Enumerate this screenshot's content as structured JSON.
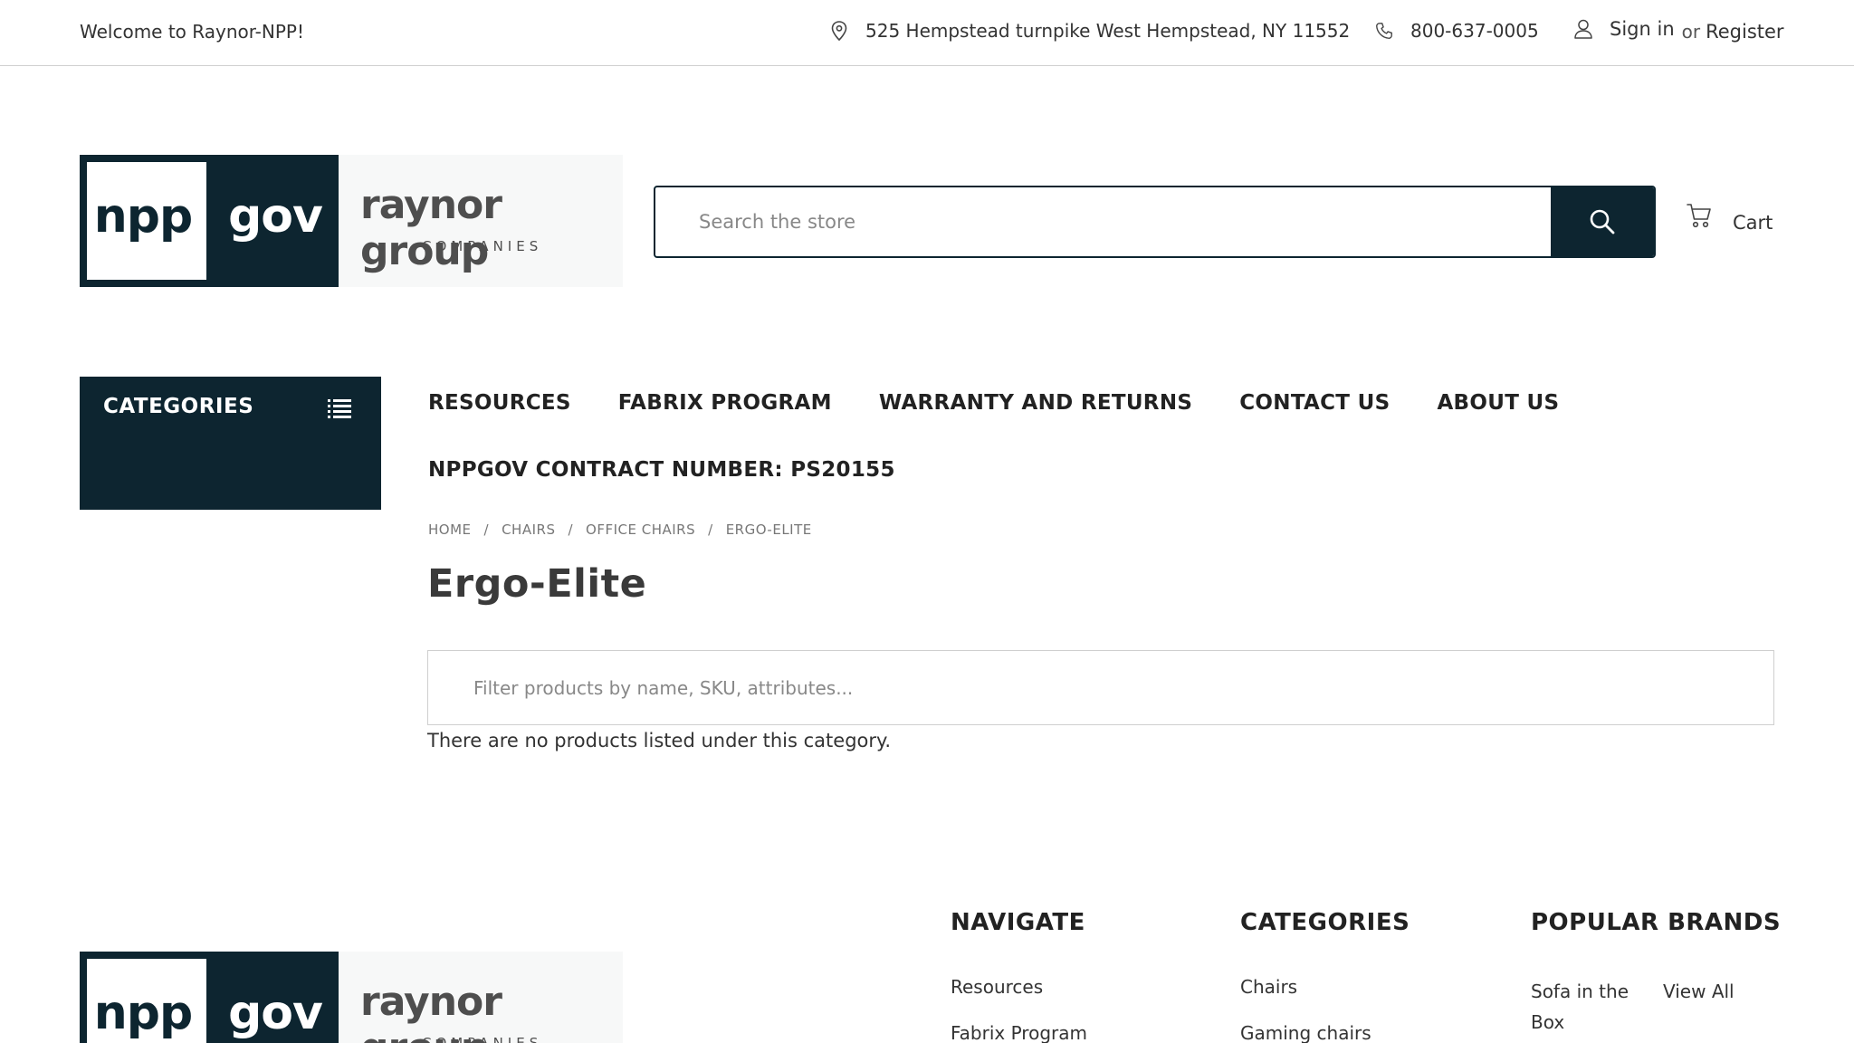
{
  "topbar": {
    "welcome": "Welcome to Raynor-NPP!",
    "address": "525 Hempstead turnpike West Hempstead, NY 11552",
    "phone": "800-637-0005",
    "sign_in": "Sign in",
    "or": "or",
    "register": "Register"
  },
  "logo": {
    "npp": "npp",
    "gov": "gov",
    "raynor": "raynor group",
    "companies": "COMPANIES"
  },
  "search": {
    "placeholder": "Search the store"
  },
  "cart": {
    "label": "Cart"
  },
  "categories_panel": {
    "title": "CATEGORIES"
  },
  "nav": {
    "items": [
      "RESOURCES",
      "FABRIX PROGRAM",
      "WARRANTY AND RETURNS",
      "CONTACT US",
      "ABOUT US"
    ],
    "contract": "NPPGOV CONTRACT NUMBER: PS20155"
  },
  "breadcrumb": [
    "HOME",
    "CHAIRS",
    "OFFICE CHAIRS",
    "ERGO-ELITE"
  ],
  "page": {
    "title": "Ergo-Elite",
    "filter_placeholder": "Filter products by name, SKU, attributes...",
    "empty_message": "There are no products listed under this category."
  },
  "footer": {
    "navigate": {
      "title": "NAVIGATE",
      "links": [
        "Resources",
        "Fabrix Program"
      ]
    },
    "categories": {
      "title": "CATEGORIES",
      "links": [
        "Chairs",
        "Gaming chairs"
      ]
    },
    "brands": {
      "title": "POPULAR BRANDS",
      "sofa": "Sofa in the Box",
      "view_all": "View All"
    }
  },
  "colors": {
    "brand_dark": "#0d2530",
    "text": "#333333",
    "border": "#cfcfcf"
  },
  "icons": [
    "map-pin-icon",
    "phone-icon",
    "user-icon",
    "search-icon",
    "cart-icon",
    "list-icon"
  ]
}
